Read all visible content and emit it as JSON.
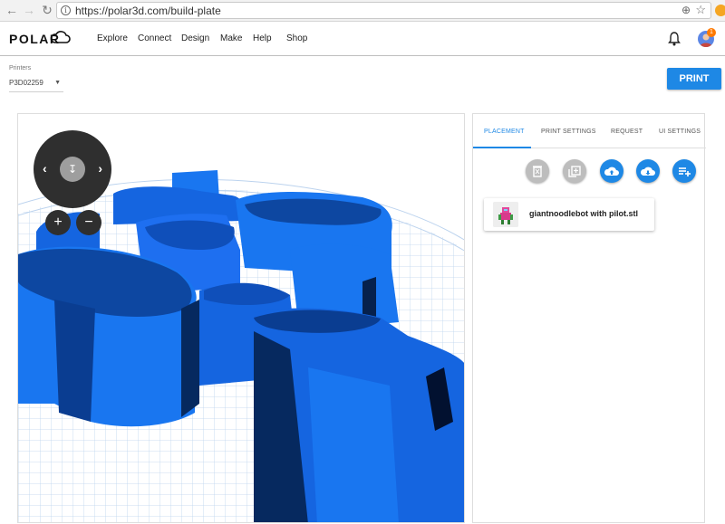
{
  "browser": {
    "url": "https://polar3d.com/build-plate"
  },
  "header": {
    "logo": "POLAR",
    "nav": [
      "Explore",
      "Connect",
      "Design",
      "Make",
      "Help",
      "Shop"
    ],
    "notification_badge": "1"
  },
  "printers": {
    "label": "Printers",
    "selected": "P3D02259"
  },
  "print_button": "PRINT",
  "panel": {
    "tabs": [
      "PLACEMENT",
      "PRINT SETTINGS",
      "REQUEST",
      "UI SETTINGS"
    ],
    "active_tab": "PLACEMENT",
    "actions": [
      "delete-icon",
      "duplicate-icon",
      "cloud-upload-icon",
      "cloud-download-icon",
      "add-list-icon"
    ],
    "files": [
      {
        "name": "giantnoodlebot with pilot.stl"
      }
    ]
  },
  "colors": {
    "accent": "#1e88e5",
    "model": "#1565e0",
    "badge": "#ff7a00"
  }
}
